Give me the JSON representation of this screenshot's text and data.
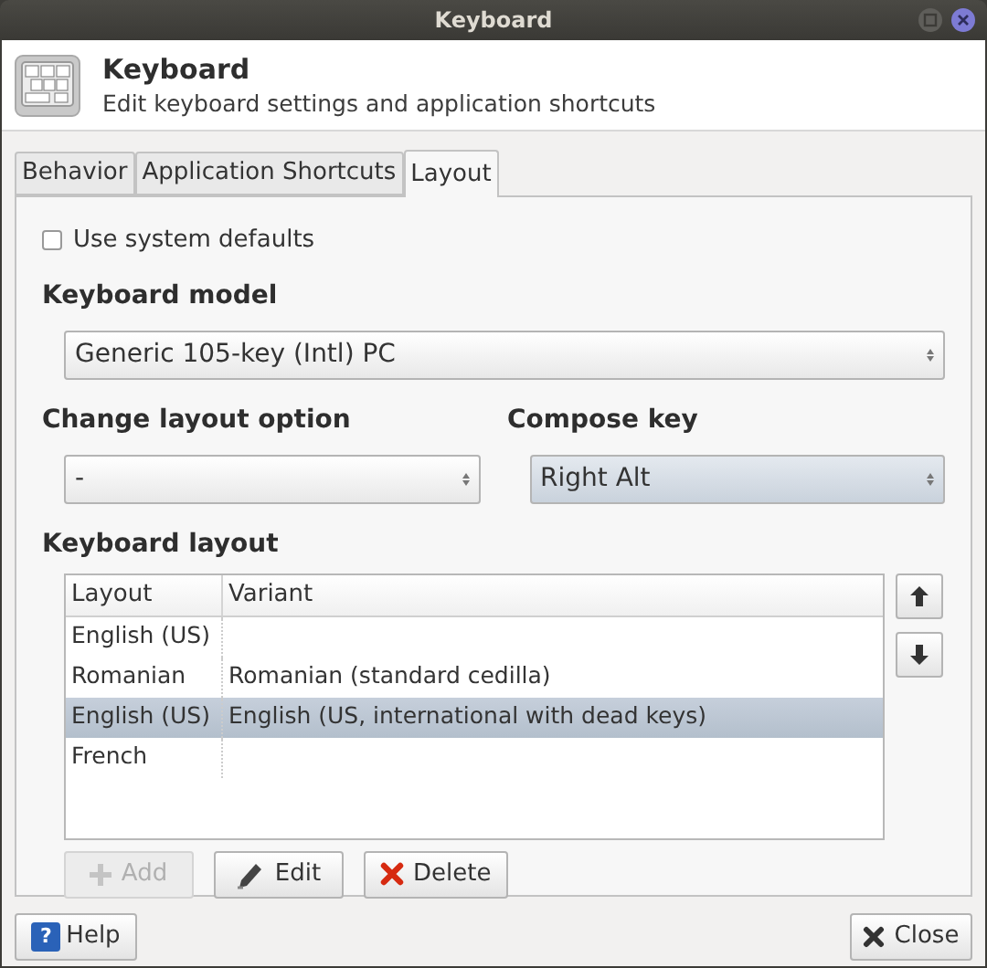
{
  "window": {
    "title": "Keyboard"
  },
  "header": {
    "title": "Keyboard",
    "subtitle": "Edit keyboard settings and application shortcuts"
  },
  "tabs": [
    {
      "label": "Behavior",
      "selected": false
    },
    {
      "label": "Application Shortcuts",
      "selected": false
    },
    {
      "label": "Layout",
      "selected": true
    }
  ],
  "use_system_defaults": {
    "label": "Use system defaults",
    "checked": false
  },
  "keyboard_model": {
    "label": "Keyboard model",
    "value": "Generic 105-key (Intl) PC"
  },
  "change_layout_option": {
    "label": "Change layout option",
    "value": "-",
    "hovered": false
  },
  "compose_key": {
    "label": "Compose key",
    "value": "Right Alt",
    "hovered": true
  },
  "keyboard_layout": {
    "label": "Keyboard layout",
    "table": {
      "columns": [
        "Layout",
        "Variant"
      ],
      "rows": [
        {
          "cells": [
            "English (US)",
            ""
          ],
          "selected": false
        },
        {
          "cells": [
            "Romanian",
            "Romanian (standard cedilla)"
          ],
          "selected": false
        },
        {
          "cells": [
            "English (US)",
            "English (US, international with dead keys)"
          ],
          "selected": true
        },
        {
          "cells": [
            "French",
            ""
          ],
          "selected": false
        }
      ]
    },
    "buttons": [
      {
        "kind": "add",
        "label": "Add",
        "disabled": true
      },
      {
        "kind": "edit",
        "label": "Edit",
        "disabled": false
      },
      {
        "kind": "delete",
        "label": "Delete",
        "disabled": false
      }
    ]
  },
  "help_button": {
    "icon": "?",
    "label": "Help"
  },
  "close_button": {
    "label": "Close"
  }
}
